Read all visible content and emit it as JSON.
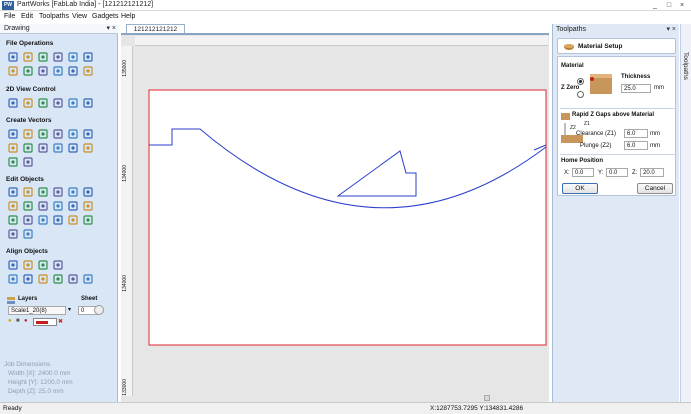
{
  "window": {
    "title": "PartWorks [FabLab India] - [121212121212]",
    "app_icon_text": "PW",
    "controls": [
      "_",
      "□",
      "×"
    ]
  },
  "menu": [
    "File",
    "Edit",
    "Toolpaths",
    "View",
    "Gadgets",
    "Help"
  ],
  "left_panel": {
    "header": "Drawing",
    "sections": {
      "file_operations": "File Operations",
      "view_control": "2D View Control",
      "create_vectors": "Create Vectors",
      "edit_objects": "Edit Objects",
      "align_objects": "Align Objects"
    },
    "layers": {
      "title": "Layers",
      "sheet_title": "Sheet",
      "layer_value": "Scale1_20(8)",
      "sheet_value": "0"
    },
    "job_dimensions": {
      "title": "Job Dimensions",
      "width": "Width  [X]: 2400.0 mm",
      "height": "Height [Y]: 1200.0 mm",
      "depth": "Depth  [Z]: 25.0 mm"
    }
  },
  "document": {
    "tab": "121212121212",
    "ruler_top_label": "",
    "ruler_left_labels": [
      "135000",
      "134000",
      "134000",
      "133000"
    ]
  },
  "status": {
    "left": "Ready",
    "coords": "X:1287753.7295 Y:134831.4286"
  },
  "right_panel": {
    "title": "Toolpaths",
    "side_tab": "Toolpaths",
    "material_setup": "Material Setup",
    "material_label": "Material",
    "thickness_label": "Thickness",
    "thickness_value": "25.0",
    "thickness_unit": "mm",
    "zzero_label": "Z Zero",
    "rapid_title": "Rapid Z Gaps above Material",
    "z1_label": "Z1",
    "z2_label": "Z2",
    "clearance_label": "Clearance (Z1)",
    "clearance_value": "6.0",
    "plunge_label": "Plunge (Z2)",
    "plunge_value": "6.0",
    "unit": "mm",
    "home_title": "Home Position",
    "x_label": "X:",
    "x_value": "0.0",
    "y_label": "Y:",
    "y_value": "0.0",
    "z_label": "Z:",
    "z_value": "20.0",
    "ok": "OK",
    "cancel": "Cancel"
  },
  "colors": {
    "panel_bg": "#d9e6f5",
    "material_border": "#e0262f",
    "vector": "#2b3fcc"
  }
}
